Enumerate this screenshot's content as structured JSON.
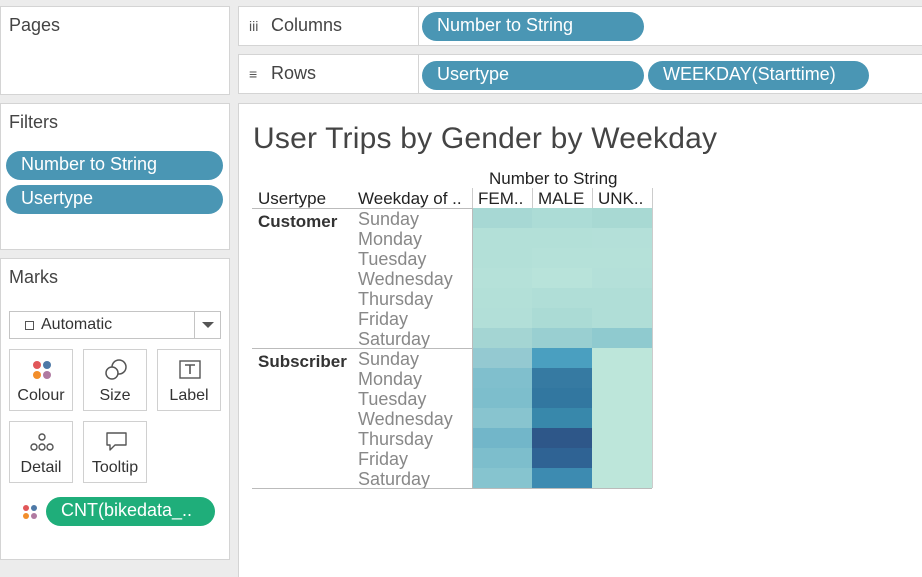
{
  "panels": {
    "pages_title": "Pages",
    "filters_title": "Filters",
    "marks_title": "Marks"
  },
  "filters": [
    "Number to String",
    "Usertype"
  ],
  "shelves": {
    "columns_label": "Columns",
    "columns_pills": [
      "Number to String"
    ],
    "rows_label": "Rows",
    "rows_pills": [
      "Usertype",
      "WEEKDAY(Starttime)"
    ]
  },
  "marks": {
    "type_value": "Automatic",
    "buttons": [
      "Colour",
      "Size",
      "Label",
      "Detail",
      "Tooltip"
    ],
    "color_field": "CNT(bikedata_.."
  },
  "view": {
    "title": "User Trips by Gender by Weekday",
    "column_header_title": "Number to String",
    "row_headers": [
      "Usertype",
      "Weekday of .."
    ],
    "columns": [
      "FEM..",
      "MALE",
      "UNK.."
    ],
    "usertypes": [
      "Customer",
      "Subscriber"
    ],
    "weekdays": [
      "Sunday",
      "Monday",
      "Tuesday",
      "Wednesday",
      "Thursday",
      "Friday",
      "Saturday"
    ]
  },
  "chart_data": {
    "type": "heatmap",
    "colors": {
      "Customer": [
        [
          "#a7d8d4",
          "#acdcd6",
          "#a8d9d3"
        ],
        [
          "#b3e0d8",
          "#b3e0d8",
          "#b4e0d9"
        ],
        [
          "#b3e0d8",
          "#b5e1d9",
          "#b5e1d9"
        ],
        [
          "#b5e1d9",
          "#b8e3da",
          "#b4e0d9"
        ],
        [
          "#b3e0d8",
          "#b0ded7",
          "#b0ded7"
        ],
        [
          "#b2dfd8",
          "#abdbd5",
          "#b0ded7"
        ],
        [
          "#a4d5d3",
          "#99cfd1",
          "#8fcacf"
        ]
      ],
      "Subscriber": [
        [
          "#94c9d1",
          "#4a9fc0",
          "#bde6da"
        ],
        [
          "#80bfcd",
          "#367aa2",
          "#bde6da"
        ],
        [
          "#7dbecc",
          "#3277a0",
          "#bde6da"
        ],
        [
          "#88c4cf",
          "#3888ab",
          "#bde6da"
        ],
        [
          "#72b6c9",
          "#2e5789",
          "#bde6da"
        ],
        [
          "#7dbecc",
          "#2f6394",
          "#bde6da"
        ],
        [
          "#86c4cf",
          "#3d8bb1",
          "#bde6da"
        ]
      ]
    }
  }
}
